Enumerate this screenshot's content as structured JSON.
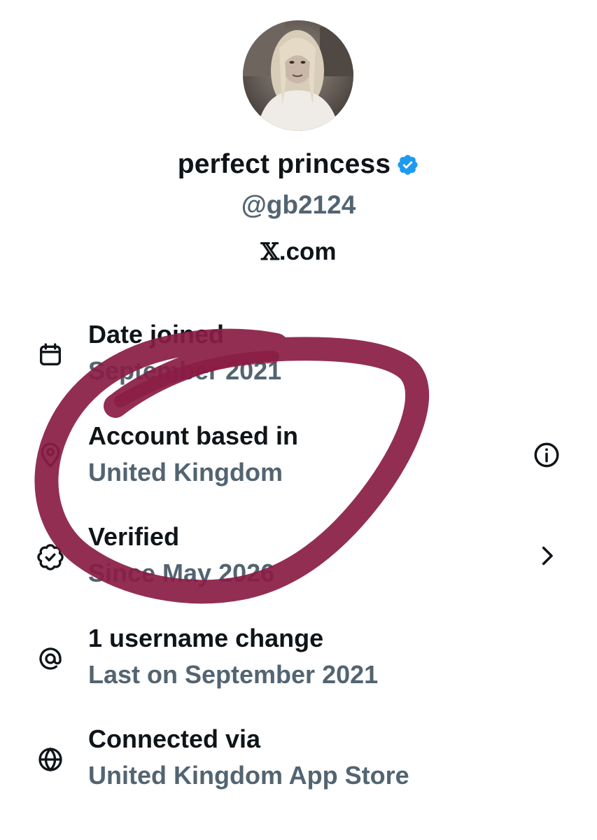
{
  "profile": {
    "display_name": "perfect princess",
    "handle": "@gb2124",
    "site_prefix": "𝕏",
    "site_suffix": ".com",
    "verified_badge_color": "#1d9bf0"
  },
  "rows": {
    "joined": {
      "title": "Date joined",
      "value": "September 2021",
      "icon": "calendar-icon"
    },
    "based": {
      "title": "Account based in",
      "value": "United Kingdom",
      "icon": "location-pin-icon",
      "trail_icon": "info-icon"
    },
    "verified": {
      "title": "Verified",
      "value": "Since May 2026",
      "icon": "verified-badge-outline-icon",
      "trail_icon": "chevron-right-icon"
    },
    "username": {
      "title": "1 username change",
      "value": "Last on September 2021",
      "icon": "at-sign-icon"
    },
    "connected": {
      "title": "Connected via",
      "value": "United Kingdom App Store",
      "icon": "globe-icon"
    }
  },
  "colors": {
    "primary_text": "#0f1419",
    "secondary_text": "#536471",
    "highlight_scribble": "#8a1c44"
  }
}
